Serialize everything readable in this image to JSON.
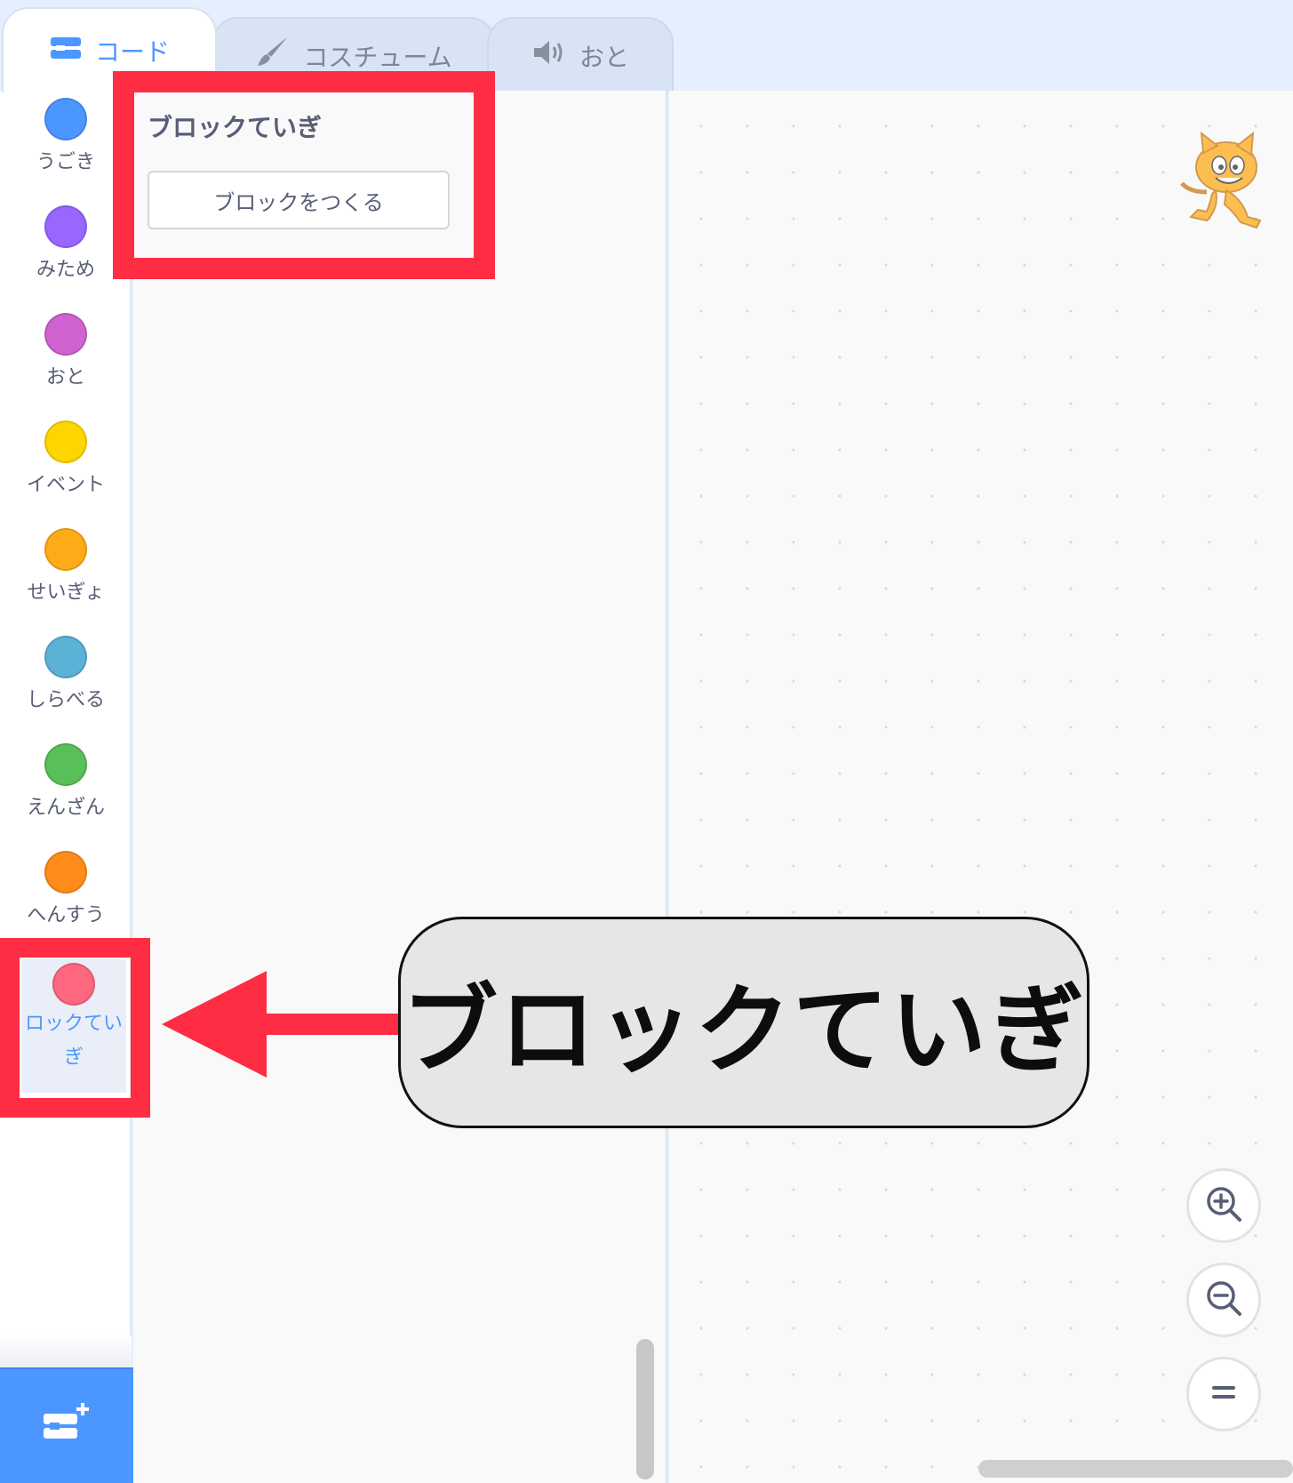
{
  "tabs": [
    {
      "label": "コード",
      "icon": "code-blocks-icon",
      "active": true
    },
    {
      "label": "コスチューム",
      "icon": "paintbrush-icon",
      "active": false
    },
    {
      "label": "おと",
      "icon": "speaker-icon",
      "active": false
    }
  ],
  "categories": [
    {
      "label": "うごき",
      "color": "#4c97ff"
    },
    {
      "label": "みため",
      "color": "#9966ff"
    },
    {
      "label": "おと",
      "color": "#cf63cf"
    },
    {
      "label": "イベント",
      "color": "#ffd500"
    },
    {
      "label": "せいぎょ",
      "color": "#ffab19"
    },
    {
      "label": "しらべる",
      "color": "#5cb1d6"
    },
    {
      "label": "えんざん",
      "color": "#59c059"
    },
    {
      "label": "へんすう",
      "color": "#ff8c1a"
    },
    {
      "label": "ロックていぎ",
      "color": "#ff6680",
      "selected": true
    }
  ],
  "palette": {
    "title": "ブロックていぎ",
    "make_block_label": "ブロックをつくる"
  },
  "zoom_controls": [
    "zoom-in-icon",
    "zoom-out-icon",
    "zoom-reset-icon"
  ],
  "extension_button_icon": "add-extension-icon",
  "annotation": {
    "callout_text": "ブロックていぎ",
    "highlight_color": "#ff2d43"
  }
}
